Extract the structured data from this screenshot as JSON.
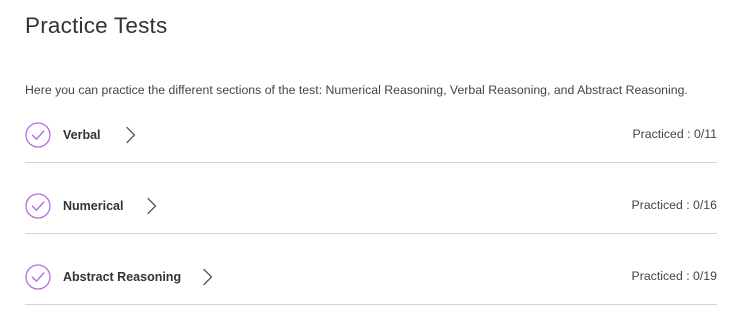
{
  "page": {
    "title": "Practice Tests",
    "intro": "Here you can practice the different sections of the test: Numerical Reasoning, Verbal Reasoning, and Abstract Reasoning."
  },
  "colors": {
    "accent": "#b46ee0",
    "divider": "#d4d4d4",
    "text": "#333333"
  },
  "icons": {
    "status": "check-circle-icon",
    "expand": "chevron-right-icon"
  },
  "sections": [
    {
      "name": "Verbal",
      "practiced": "Practiced : 0/11"
    },
    {
      "name": "Numerical",
      "practiced": "Practiced : 0/16"
    },
    {
      "name": "Abstract Reasoning",
      "practiced": "Practiced : 0/19"
    }
  ]
}
